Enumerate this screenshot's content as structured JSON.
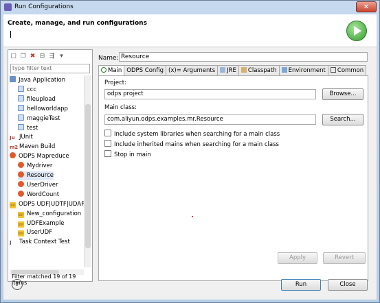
{
  "window": {
    "title": "Run Configurations",
    "close_label": "✕"
  },
  "header": {
    "title": "Create, manage, and run configurations"
  },
  "left": {
    "filter_placeholder": "type filter text",
    "tree": [
      {
        "label": "Java Application",
        "indent": 0,
        "icon": "java-app-icon"
      },
      {
        "label": "ccc",
        "indent": 1,
        "icon": "config-icon"
      },
      {
        "label": "fileupload",
        "indent": 1,
        "icon": "config-icon"
      },
      {
        "label": "helloworldapp",
        "indent": 1,
        "icon": "config-icon"
      },
      {
        "label": "maggieTest",
        "indent": 1,
        "icon": "config-icon"
      },
      {
        "label": "test",
        "indent": 1,
        "icon": "config-icon"
      },
      {
        "label": "JUnit",
        "indent": 0,
        "icon": "junit-icon"
      },
      {
        "label": "Maven Build",
        "indent": 0,
        "icon": "maven-icon"
      },
      {
        "label": "ODPS Mapreduce",
        "indent": 0,
        "icon": "odps-icon"
      },
      {
        "label": "Mydriver",
        "indent": 1,
        "icon": "odps-icon"
      },
      {
        "label": "Resource",
        "indent": 1,
        "icon": "odps-icon",
        "selected": true
      },
      {
        "label": "UserDriver",
        "indent": 1,
        "icon": "odps-icon"
      },
      {
        "label": "WordCount",
        "indent": 1,
        "icon": "odps-icon"
      },
      {
        "label": "ODPS UDF|UDTF|UDAF",
        "indent": 0,
        "icon": "udf-icon"
      },
      {
        "label": "New_configuration",
        "indent": 1,
        "icon": "udf-icon"
      },
      {
        "label": "UDFExample",
        "indent": 1,
        "icon": "udf-icon"
      },
      {
        "label": "UserUDF",
        "indent": 1,
        "icon": "udf-icon"
      },
      {
        "label": "Task Context Test",
        "indent": 0,
        "icon": "task-context-icon"
      }
    ],
    "filter_status": "Filter matched 19 of 19 items"
  },
  "right": {
    "name_label": "Name:",
    "name_value": "Resource",
    "tabs": [
      "Main",
      "ODPS Config",
      "(x)= Arguments",
      "JRE",
      "Classpath",
      "Environment",
      "Common"
    ],
    "project_label": "Project:",
    "project_value": "odps project",
    "browse_label": "Browse...",
    "main_class_label": "Main class:",
    "main_class_value": "com.aliyun.odps.examples.mr.Resource",
    "search_label": "Search...",
    "checkboxes": [
      "Include system libraries when searching for a main class",
      "Include inherited mains when searching for a main class",
      "Stop in main"
    ],
    "apply_label": "Apply",
    "revert_label": "Revert"
  },
  "footer": {
    "help_label": "?",
    "run_label": "Run",
    "close_label": "Close"
  }
}
